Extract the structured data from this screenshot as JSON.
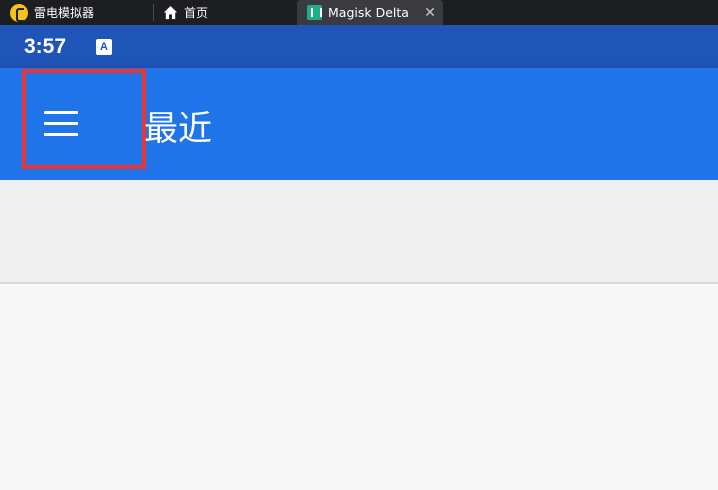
{
  "titlebar": {
    "app_name": "雷电模拟器",
    "home_tab_label": "首页",
    "active_tab_label": "Magisk Delta",
    "close_glyph": "✕"
  },
  "statusbar": {
    "time": "3:57",
    "notification_letter": "A"
  },
  "toolbar": {
    "title": "最近",
    "menu_icon": "hamburger-menu-icon"
  },
  "colors": {
    "status_bar": "#1f54b8",
    "toolbar": "#1e74e8",
    "highlight": "#e8353a",
    "brand_yellow": "#f6c21a",
    "magisk_green": "#1fae8a"
  }
}
